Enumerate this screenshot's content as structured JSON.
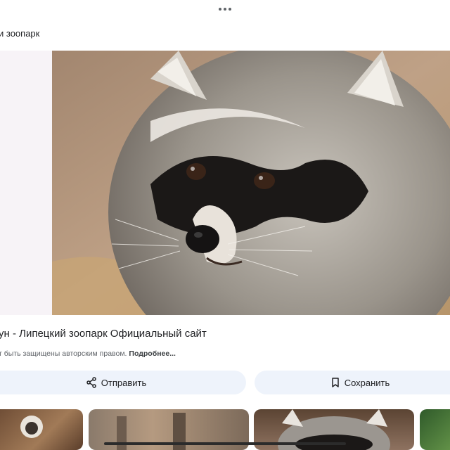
{
  "source": {
    "name": "и зоопарк"
  },
  "image": {
    "subject": "raccoon-photo"
  },
  "result": {
    "title": "ун - Липецкий зоопарк Официальный сайт",
    "copyright_text": "т быть защищены авторским правом.",
    "more_link": "Подробнее..."
  },
  "actions": {
    "share_label": "Отправить",
    "save_label": "Сохранить"
  },
  "colors": {
    "button_bg": "#eef3fb",
    "left_pane_bg": "#f7f3f7"
  }
}
